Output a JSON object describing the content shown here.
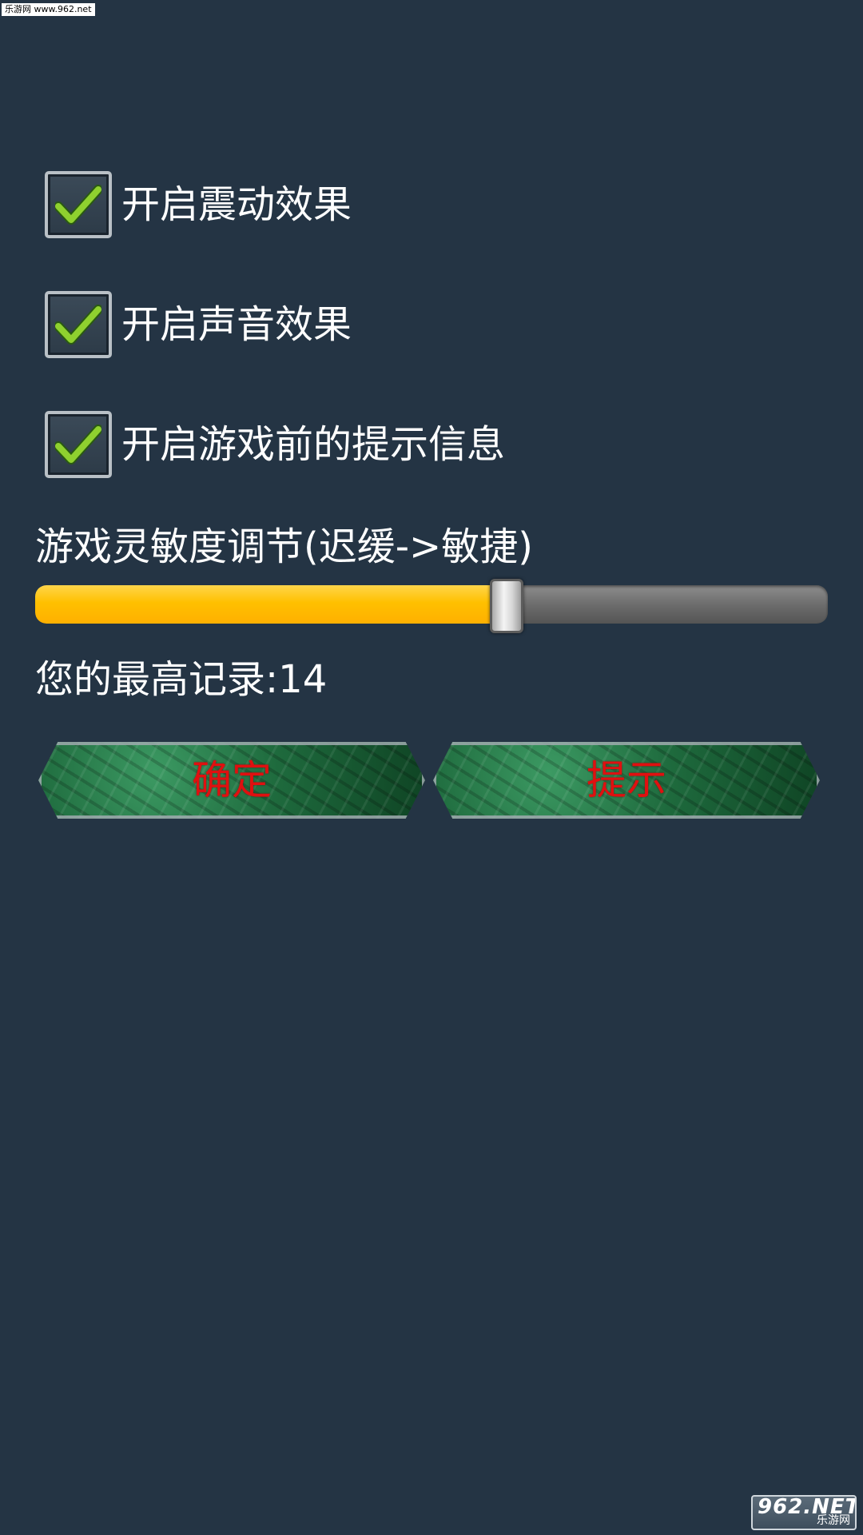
{
  "watermark": {
    "top_text": "乐游网 www.962.net",
    "logo_main": "962.NET",
    "logo_sub": "乐游网"
  },
  "options": [
    {
      "label": "开启震动效果",
      "checked": true
    },
    {
      "label": "开启声音效果",
      "checked": true
    },
    {
      "label": "开启游戏前的提示信息",
      "checked": true
    }
  ],
  "sensitivity": {
    "title": "游戏灵敏度调节(迟缓->敏捷)",
    "value_fraction": 0.595
  },
  "record": {
    "text": "您的最高记录:14"
  },
  "buttons": {
    "confirm_label": "确定",
    "hint_label": "提示"
  },
  "colors": {
    "background": "#243444",
    "slider_fill": "#ffc000",
    "button_text": "#e01010",
    "check_green": "#8fd12f"
  }
}
